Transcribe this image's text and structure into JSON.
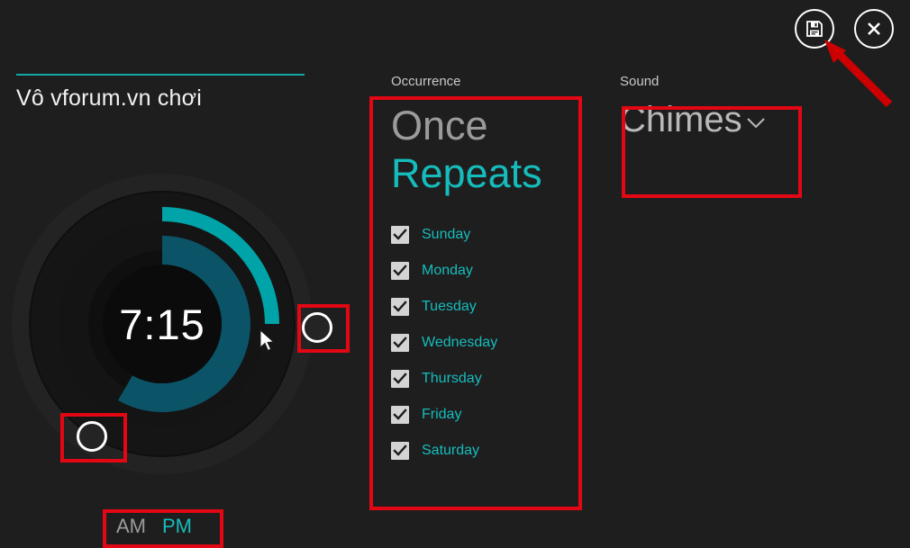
{
  "window": {
    "save_label": "Save",
    "close_label": "Close",
    "save_icon": "save-floppy-icon",
    "close_icon": "close-x-icon"
  },
  "alarm": {
    "name": "Vô vforum.vn chơi",
    "time": "7:15",
    "hour": 7,
    "minute": 15,
    "meridiem_options": [
      "AM",
      "PM"
    ],
    "meridiem_selected": "PM"
  },
  "occurrence": {
    "label": "Occurrence",
    "options": [
      "Once",
      "Repeats"
    ],
    "selected": "Repeats",
    "days": [
      {
        "label": "Sunday",
        "checked": true
      },
      {
        "label": "Monday",
        "checked": true
      },
      {
        "label": "Tuesday",
        "checked": true
      },
      {
        "label": "Wednesday",
        "checked": true
      },
      {
        "label": "Thursday",
        "checked": true
      },
      {
        "label": "Friday",
        "checked": true
      },
      {
        "label": "Saturday",
        "checked": true
      }
    ]
  },
  "sound": {
    "label": "Sound",
    "selected": "Chimes",
    "chevron_icon": "chevron-down-icon"
  },
  "colors": {
    "background": "#1e1e1e",
    "accent_teal": "#16bcbc",
    "ring_outer": "#00a3a8",
    "ring_inner": "#0b5468",
    "annotation_red": "#e30613",
    "muted_text": "#9b9b9b"
  }
}
